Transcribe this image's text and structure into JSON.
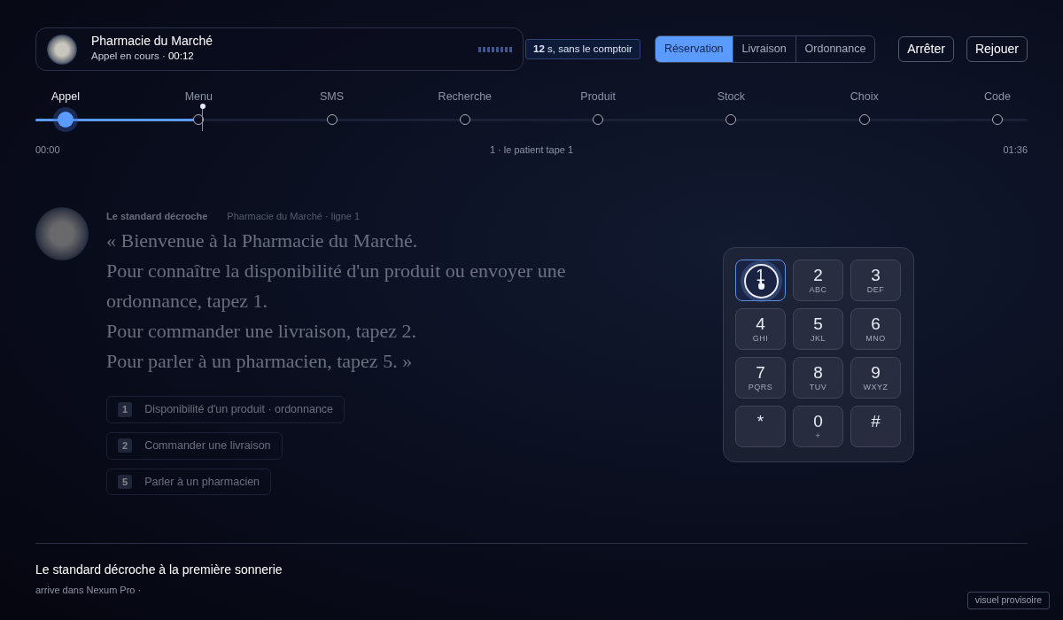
{
  "call": {
    "name": "Pharmacie du Marché",
    "status": "Appel en cours ·",
    "time": "00:12"
  },
  "badge": "**12** s, sans le comptoir",
  "scenarios": [
    {
      "label": "Réservation",
      "selected": true
    },
    {
      "label": "Livraison",
      "selected": false
    },
    {
      "label": "Ordonnance",
      "selected": false
    }
  ],
  "buttons": [
    "Arrêter",
    "Rejouer"
  ],
  "timeline": {
    "level": 0.168,
    "steps": [
      {
        "label": "Appel",
        "selected": true
      },
      {
        "label": "Menu",
        "selected": false
      },
      {
        "label": "SMS",
        "selected": false
      },
      {
        "label": "Recherche",
        "selected": false
      },
      {
        "label": "Produit",
        "selected": false
      },
      {
        "label": "Stock",
        "selected": false
      },
      {
        "label": "Choix",
        "selected": false
      },
      {
        "label": "Code",
        "selected": false
      }
    ],
    "start": "00:00",
    "caption": "1 · le patient tape 1",
    "end": "01:36"
  },
  "message": {
    "sender": "Le standard décroche",
    "line": "Pharmacie du Marché · ligne 1",
    "lines": [
      "« Bienvenue à la Pharmacie du Marché.",
      "Pour connaître la disponibilité d'un produit ou envoyer une ordonnance, tapez 1.",
      "Pour commander une livraison, tapez 2.",
      "Pour parler à un pharmacien, tapez 5. »"
    ],
    "options": [
      {
        "key": "1",
        "label": "Disponibilité d'un produit · ordonnance"
      },
      {
        "key": "2",
        "label": "Commander une livraison"
      },
      {
        "key": "5",
        "label": "Parler à un pharmacien"
      }
    ]
  },
  "keypad": [
    {
      "digit": "1",
      "selected": true
    },
    {
      "digit": "2",
      "letters": "ABC",
      "selected": false
    },
    {
      "digit": "3",
      "letters": "DEF",
      "selected": false
    },
    {
      "digit": "4",
      "letters": "GHI",
      "selected": false
    },
    {
      "digit": "5",
      "letters": "JKL",
      "selected": false
    },
    {
      "digit": "6",
      "letters": "MNO",
      "selected": false
    },
    {
      "digit": "7",
      "letters": "PQRS",
      "selected": false
    },
    {
      "digit": "8",
      "letters": "TUV",
      "selected": false
    },
    {
      "digit": "9",
      "letters": "WXYZ",
      "selected": false
    },
    {
      "digit": "*",
      "selected": false
    },
    {
      "digit": "0",
      "letters": "+",
      "selected": false
    },
    {
      "digit": "#",
      "selected": false
    }
  ],
  "footer": {
    "title": "Le standard décroche à la première sonnerie",
    "subtitle": "arrive dans Nexum Pro ·",
    "tag": "visuel provisoire"
  }
}
